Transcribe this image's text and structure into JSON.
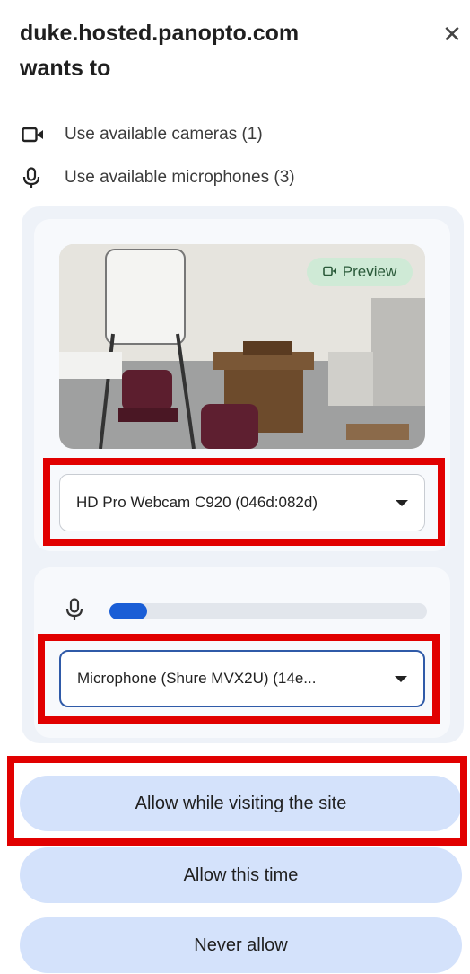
{
  "dialog": {
    "site": "duke.hosted.panopto.com",
    "subtitle": "wants to",
    "close_icon": "close-icon",
    "permissions": [
      {
        "icon": "camera-icon",
        "label": "Use available cameras (1)"
      },
      {
        "icon": "microphone-icon",
        "label": "Use available microphones (3)"
      }
    ]
  },
  "camera": {
    "preview_label": "Preview",
    "selected_device": "HD Pro Webcam C920 (046d:082d)"
  },
  "microphone": {
    "level": 0.12,
    "selected_device": "Microphone (Shure MVX2U) (14e..."
  },
  "buttons": {
    "allow_site": "Allow while visiting the site",
    "allow_once": "Allow this time",
    "never": "Never allow"
  },
  "colors": {
    "highlight": "#e10000",
    "button_bg": "#d4e2fb",
    "meter": "#1a5ed6"
  }
}
